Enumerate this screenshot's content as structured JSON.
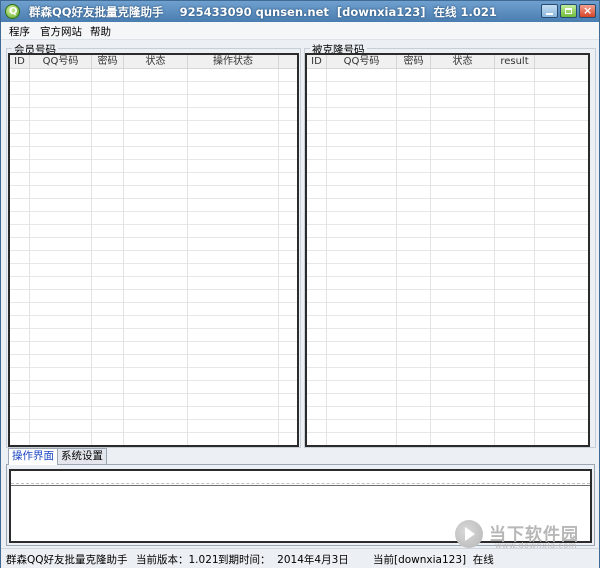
{
  "window": {
    "title": "群森QQ好友批量克隆助手    925433090 qunsen.net  [downxia123]  在线 1.021"
  },
  "menu": [
    "程序",
    "官方网站",
    "帮助"
  ],
  "left_group": {
    "label": "会员号码",
    "columns": [
      "ID",
      "QQ号码",
      "密码",
      "状态",
      "操作状态"
    ]
  },
  "right_group": {
    "label": "被克隆号码",
    "columns": [
      "ID",
      "QQ号码",
      "密码",
      "状态",
      "result"
    ]
  },
  "tabs": [
    "操作界面",
    "系统设置"
  ],
  "watermark": {
    "name": "当下软件园",
    "domain": "www.downxia.com"
  },
  "status": {
    "app_name": "群森QQ好友批量克隆助手",
    "version": "当前版本：1.021",
    "expiry": "到期时间：  2014年4月3日",
    "user": "当前[downxia123]  在线"
  }
}
